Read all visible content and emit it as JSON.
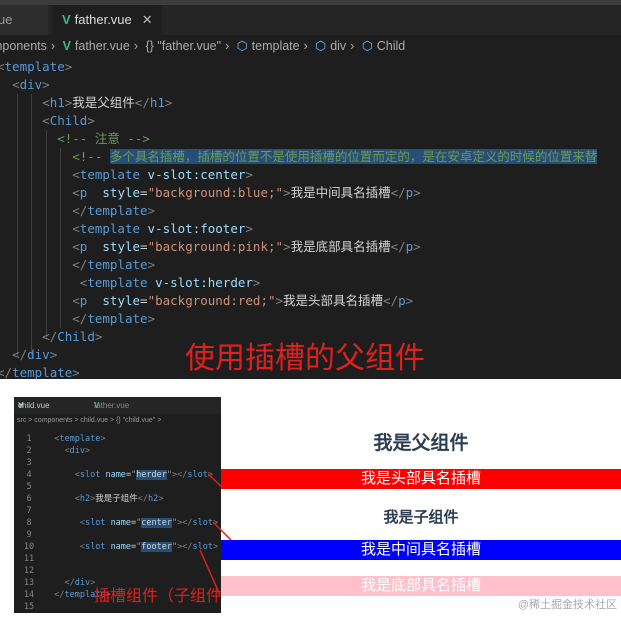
{
  "top_editor": {
    "tabs": [
      {
        "label": "ue"
      },
      {
        "label": "father.vue",
        "active": true
      }
    ],
    "breadcrumb": [
      "mponents",
      "father.vue",
      "{} \"father.vue\"",
      "template",
      "div",
      "Child"
    ],
    "lines": [
      {
        "indent": 0,
        "tokens": [
          [
            "br",
            "<"
          ],
          [
            "tag",
            "template"
          ],
          [
            "br",
            ">"
          ]
        ]
      },
      {
        "indent": 2,
        "tokens": [
          [
            "br",
            "<"
          ],
          [
            "tag",
            "div"
          ],
          [
            "br",
            ">"
          ]
        ]
      },
      {
        "indent": 6,
        "tokens": [
          [
            "br",
            "<"
          ],
          [
            "tag",
            "h1"
          ],
          [
            "br",
            ">"
          ],
          [
            "txt",
            "我是父组件"
          ],
          [
            "br",
            "</"
          ],
          [
            "tag",
            "h1"
          ],
          [
            "br",
            ">"
          ]
        ]
      },
      {
        "indent": 6,
        "tokens": [
          [
            "br",
            "<"
          ],
          [
            "tag",
            "Child"
          ],
          [
            "br",
            ">"
          ]
        ]
      },
      {
        "indent": 8,
        "tokens": [
          [
            "com",
            "<!-- 注意 -->"
          ]
        ]
      },
      {
        "indent": 10,
        "tokens": [
          [
            "com",
            "<!-- "
          ],
          [
            "sel",
            "多个具名插槽，插槽的位置不是使用插槽的位置而定的，是在安卓定义的时候的位置来替"
          ]
        ]
      },
      {
        "indent": 10,
        "tokens": [
          [
            "br",
            "<"
          ],
          [
            "tag",
            "template"
          ],
          [
            "txt",
            " "
          ],
          [
            "attr",
            "v-slot:center"
          ],
          [
            "br",
            ">"
          ]
        ]
      },
      {
        "indent": 10,
        "tokens": [
          [
            "br",
            "<"
          ],
          [
            "tag",
            "p"
          ],
          [
            "txt",
            "  "
          ],
          [
            "attr",
            "style"
          ],
          [
            "txt",
            "="
          ],
          [
            "str",
            "\"background:blue;\""
          ],
          [
            "br",
            ">"
          ],
          [
            "txt",
            "我是中间具名插槽"
          ],
          [
            "br",
            "</"
          ],
          [
            "tag",
            "p"
          ],
          [
            "br",
            ">"
          ]
        ]
      },
      {
        "indent": 10,
        "tokens": [
          [
            "br",
            "</"
          ],
          [
            "tag",
            "template"
          ],
          [
            "br",
            ">"
          ]
        ]
      },
      {
        "indent": 10,
        "tokens": [
          [
            "br",
            "<"
          ],
          [
            "tag",
            "template"
          ],
          [
            "txt",
            " "
          ],
          [
            "attr",
            "v-slot:footer"
          ],
          [
            "br",
            ">"
          ]
        ]
      },
      {
        "indent": 10,
        "tokens": [
          [
            "br",
            "<"
          ],
          [
            "tag",
            "p"
          ],
          [
            "txt",
            "  "
          ],
          [
            "attr",
            "style"
          ],
          [
            "txt",
            "="
          ],
          [
            "str",
            "\"background:pink;\""
          ],
          [
            "br",
            ">"
          ],
          [
            "txt",
            "我是底部具名插槽"
          ],
          [
            "br",
            "</"
          ],
          [
            "tag",
            "p"
          ],
          [
            "br",
            ">"
          ]
        ]
      },
      {
        "indent": 10,
        "tokens": [
          [
            "br",
            "</"
          ],
          [
            "tag",
            "template"
          ],
          [
            "br",
            ">"
          ]
        ]
      },
      {
        "indent": 11,
        "tokens": [
          [
            "br",
            "<"
          ],
          [
            "tag",
            "template"
          ],
          [
            "txt",
            " "
          ],
          [
            "attr",
            "v-slot:herder"
          ],
          [
            "br",
            ">"
          ]
        ]
      },
      {
        "indent": 10,
        "tokens": [
          [
            "br",
            "<"
          ],
          [
            "tag",
            "p"
          ],
          [
            "txt",
            "  "
          ],
          [
            "attr",
            "style"
          ],
          [
            "txt",
            "="
          ],
          [
            "str",
            "\"background:red;\""
          ],
          [
            "br",
            ">"
          ],
          [
            "txt",
            "我是头部具名插槽"
          ],
          [
            "br",
            "</"
          ],
          [
            "tag",
            "p"
          ],
          [
            "br",
            ">"
          ]
        ]
      },
      {
        "indent": 10,
        "tokens": [
          [
            "br",
            "</"
          ],
          [
            "tag",
            "template"
          ],
          [
            "br",
            ">"
          ]
        ]
      },
      {
        "indent": 6,
        "tokens": [
          [
            "br",
            "</"
          ],
          [
            "tag",
            "Child"
          ],
          [
            "br",
            ">"
          ]
        ]
      },
      {
        "indent": 2,
        "tokens": [
          [
            "br",
            "</"
          ],
          [
            "tag",
            "div"
          ],
          [
            "br",
            ">"
          ]
        ]
      },
      {
        "indent": 0,
        "tokens": [
          [
            "br",
            "</"
          ],
          [
            "tag",
            "template"
          ],
          [
            "br",
            ">"
          ]
        ]
      }
    ],
    "caption": "使用插槽的父组件"
  },
  "child_editor": {
    "tabs": [
      {
        "label": "child.vue",
        "active": true
      },
      {
        "label": "father.vue"
      }
    ],
    "breadcrumb": "src > components > child.vue > {} \"child.vue\" >",
    "lines": [
      {
        "n": "1",
        "indent": 2,
        "tokens": [
          [
            "br",
            "<"
          ],
          [
            "tag",
            "template"
          ],
          [
            "br",
            ">"
          ]
        ]
      },
      {
        "n": "2",
        "indent": 4,
        "tokens": [
          [
            "br",
            "<"
          ],
          [
            "tag",
            "div"
          ],
          [
            "br",
            ">"
          ]
        ]
      },
      {
        "n": "3",
        "indent": 0,
        "tokens": []
      },
      {
        "n": "4",
        "indent": 6,
        "tokens": [
          [
            "br",
            "<"
          ],
          [
            "tag",
            "slot"
          ],
          [
            "txt",
            " "
          ],
          [
            "attr",
            "name"
          ],
          [
            "txt",
            "="
          ],
          [
            "str",
            "\""
          ],
          [
            "sel2",
            "herder"
          ],
          [
            "str",
            "\""
          ],
          [
            "br",
            "></"
          ],
          [
            "tag",
            "slot"
          ],
          [
            "br",
            ">"
          ]
        ]
      },
      {
        "n": "5",
        "indent": 0,
        "tokens": []
      },
      {
        "n": "6",
        "indent": 6,
        "tokens": [
          [
            "br",
            "<"
          ],
          [
            "tag",
            "h2"
          ],
          [
            "br",
            ">"
          ],
          [
            "txt",
            "我是子组件"
          ],
          [
            "br",
            "</"
          ],
          [
            "tag",
            "h2"
          ],
          [
            "br",
            ">"
          ]
        ]
      },
      {
        "n": "7",
        "indent": 0,
        "tokens": []
      },
      {
        "n": "8",
        "indent": 7,
        "tokens": [
          [
            "br",
            "<"
          ],
          [
            "tag",
            "slot"
          ],
          [
            "txt",
            " "
          ],
          [
            "attr",
            "name"
          ],
          [
            "txt",
            "="
          ],
          [
            "str",
            "\""
          ],
          [
            "sel2",
            "center"
          ],
          [
            "str",
            "\""
          ],
          [
            "br",
            "></"
          ],
          [
            "tag",
            "slot"
          ],
          [
            "br",
            ">"
          ]
        ]
      },
      {
        "n": "9",
        "indent": 0,
        "tokens": []
      },
      {
        "n": "10",
        "indent": 7,
        "tokens": [
          [
            "br",
            "<"
          ],
          [
            "tag",
            "slot"
          ],
          [
            "txt",
            " "
          ],
          [
            "attr",
            "name"
          ],
          [
            "txt",
            "="
          ],
          [
            "str",
            "\""
          ],
          [
            "sel2",
            "footer"
          ],
          [
            "str",
            "\""
          ],
          [
            "br",
            "></"
          ],
          [
            "tag",
            "slot"
          ],
          [
            "br",
            ">"
          ]
        ]
      },
      {
        "n": "11",
        "indent": 0,
        "tokens": []
      },
      {
        "n": "12",
        "indent": 0,
        "tokens": []
      },
      {
        "n": "13",
        "indent": 4,
        "tokens": [
          [
            "br",
            "</"
          ],
          [
            "tag",
            "div"
          ],
          [
            "br",
            ">"
          ]
        ]
      },
      {
        "n": "14",
        "indent": 2,
        "tokens": [
          [
            "br",
            "</"
          ],
          [
            "tag",
            "template"
          ],
          [
            "br",
            ">"
          ]
        ]
      },
      {
        "n": "15",
        "indent": 0,
        "tokens": []
      }
    ],
    "caption": "插槽组件（子组件）"
  },
  "preview": {
    "h1": "我是父组件",
    "header_slot": "我是头部具名插槽",
    "h2": "我是子组件",
    "center_slot": "我是中间具名插槽",
    "footer_slot": "我是底部具名插槽",
    "colors": {
      "header": "#ff0000",
      "center": "#0000ff",
      "footer": "#ffc0cb"
    }
  },
  "watermark": "@稀土掘金技术社区"
}
